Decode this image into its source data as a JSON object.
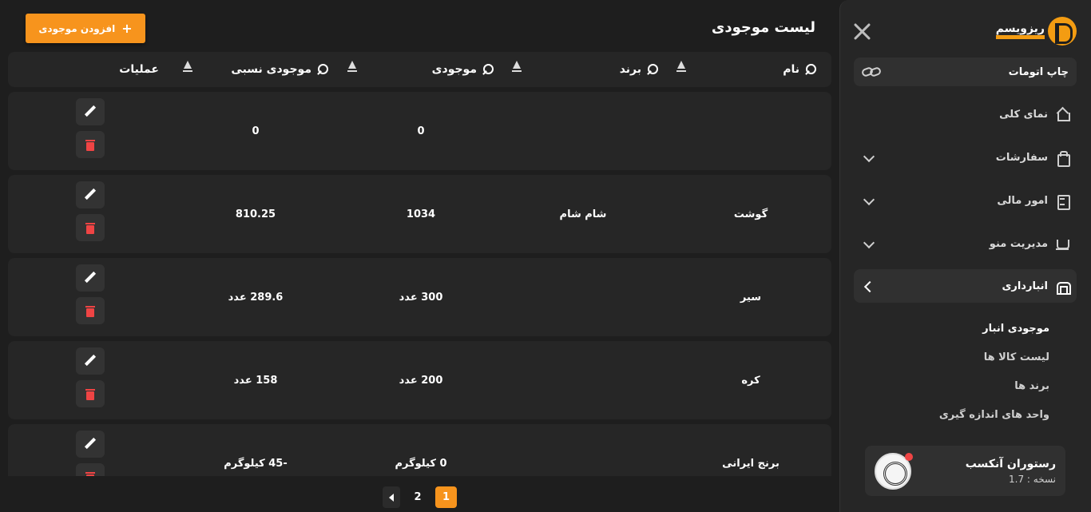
{
  "sidebar": {
    "logo_text": "ریزویسم",
    "print_label": "چاپ اتومات",
    "nav": [
      {
        "label": "نمای کلی",
        "icon": "home-icon"
      },
      {
        "label": "سفارشات",
        "icon": "shopping-bag-icon"
      },
      {
        "label": "امور مالی",
        "icon": "receipt-icon"
      },
      {
        "label": "مدیریت منو",
        "icon": "cup-icon"
      },
      {
        "label": "انبارداری",
        "icon": "warehouse-icon",
        "active": true
      }
    ],
    "subnav": [
      {
        "label": "موجودی انبار",
        "active": true
      },
      {
        "label": "لیست کالا ها"
      },
      {
        "label": "برند ها"
      },
      {
        "label": "واحد های اندازه گیری"
      }
    ],
    "profile": {
      "name": "رستوران آنکسب",
      "version": "نسخه : 1.7"
    }
  },
  "main": {
    "title": "لیست موجودی",
    "add_button": "افزودن موجودی",
    "columns": {
      "name": "نام",
      "brand": "برند",
      "stock": "موجودی",
      "relative": "موجودی نسبی",
      "actions": "عملیات"
    },
    "rows": [
      {
        "name": "",
        "brand": "",
        "stock": "0",
        "relative": "0"
      },
      {
        "name": "گوشت",
        "brand": "شام شام",
        "stock": "1034",
        "relative": "810.25"
      },
      {
        "name": "سیر",
        "brand": "",
        "stock": "300 عدد",
        "relative": "289.6 عدد"
      },
      {
        "name": "کره",
        "brand": "",
        "stock": "200 عدد",
        "relative": "158 عدد"
      },
      {
        "name": "برنج ایرانی",
        "brand": "",
        "stock": "0 کیلوگرم",
        "relative": "-45 کیلوگرم"
      }
    ],
    "pagination": {
      "pages": [
        "1",
        "2"
      ],
      "current": "1"
    }
  },
  "colors": {
    "accent": "#f7941d",
    "background": "#1e1e1e",
    "panel": "#262626",
    "danger": "#ef4444"
  }
}
